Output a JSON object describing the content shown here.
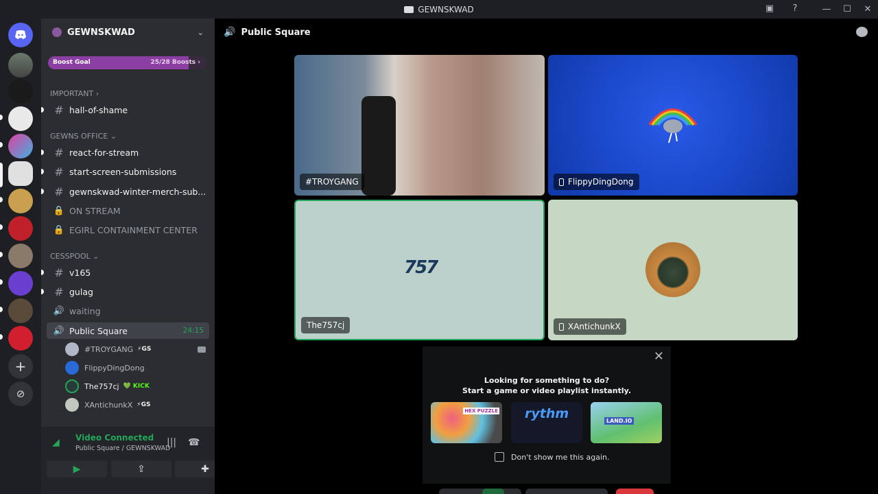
{
  "window": {
    "title": "GEWNSKWAD"
  },
  "titlebar_icons": [
    "inbox-icon",
    "help-icon"
  ],
  "window_controls": [
    "minimize",
    "maximize",
    "close"
  ],
  "guild": {
    "name": "GEWNSKWAD"
  },
  "boost": {
    "label": "Boost Goal",
    "count": "25/28 Boosts",
    "progress": 0.8929
  },
  "categories": {
    "important": "IMPORTANT",
    "office": "GEWNS OFFICE",
    "cesspool": "CESSPOOL"
  },
  "channels": {
    "hall_of_shame": "hall-of-shame",
    "react": "react-for-stream",
    "start_screen": "start-screen-submissions",
    "merch": "gewnskwad-winter-merch-sub...",
    "on_stream": "ON STREAM",
    "egirl": "EGIRL CONTAINMENT CENTER",
    "v165": "v165",
    "gulag": "gulag",
    "waiting": "waiting",
    "public_square": "Public Square",
    "public_square_time": "24:15"
  },
  "voice_users": [
    {
      "name": "#TROYGANG",
      "badge": "⚡GS"
    },
    {
      "name": "FlippyDingDong",
      "badge": ""
    },
    {
      "name": "The757cj",
      "badge": "💚 KICK"
    },
    {
      "name": "XAntichunkX",
      "badge": "⚡GS"
    }
  ],
  "voice_panel": {
    "status": "Video Connected",
    "location": "Public Square / GEWNSKWAD"
  },
  "main": {
    "channel": "Public Square"
  },
  "tiles": [
    {
      "name": "#TROYGANG"
    },
    {
      "name": "FlippyDingDong"
    },
    {
      "name": "The757cj",
      "logo": "757"
    },
    {
      "name": "XAntichunkX"
    }
  ],
  "activity": {
    "line1": "Looking for something to do?",
    "line2": "Start a game or video playlist instantly.",
    "cards": [
      "HEX PUZZLE",
      "rythm",
      "LAND.IO"
    ],
    "dont_show": "Don't show me this again."
  },
  "colors": {
    "accent_green": "#23a55a",
    "blurple": "#5865f2",
    "danger": "#da373c"
  }
}
